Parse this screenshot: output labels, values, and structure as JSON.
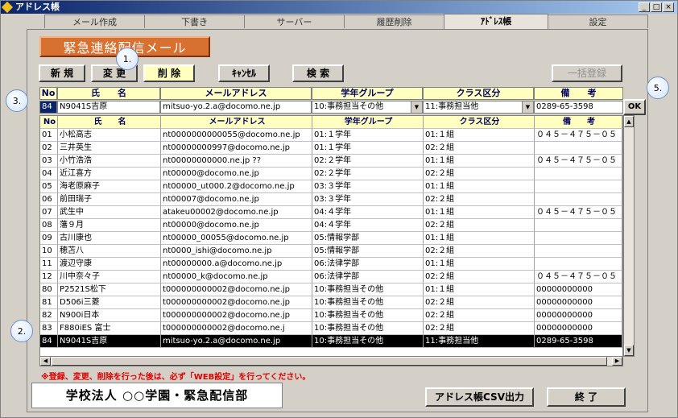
{
  "window": {
    "title": "アドレス帳"
  },
  "tabs": [
    "メール作成",
    "下書き",
    "サーバー",
    "履歴削除",
    "ｱﾄﾞﾚｽ帳",
    "設定"
  ],
  "active_tab_index": 4,
  "banner": {
    "text": "緊急連絡配信メール"
  },
  "toolbar": {
    "new_label": "新 規",
    "edit_label": "変 更",
    "delete_label": "削 除",
    "cancel_label": "ｷｬﾝｾﾙ",
    "search_label": "検 索",
    "bulk_label": "一括登録"
  },
  "callouts": {
    "c1": "1.",
    "c2": "2.",
    "c3": "3.",
    "c5": "5."
  },
  "form": {
    "headers": {
      "no": "No",
      "name": "氏　　名",
      "email": "メールアドレス",
      "grade": "学年グループ",
      "class": "クラス区分",
      "note": "備　　考"
    },
    "values": {
      "no": "84",
      "name": "N9041S吉原",
      "email": "mitsuo-yo.2.a@docomo.ne.jp",
      "grade": "10:事務担当その他",
      "class": "11:事務担当他",
      "note": "0289-65-3598"
    },
    "ok_label": "OK"
  },
  "grid": {
    "headers": {
      "no": "No",
      "name": "氏　　名",
      "email": "メールアドレス",
      "grade": "学年グループ",
      "class": "クラス区分",
      "note": "備　　考"
    },
    "rows": [
      {
        "no": "01",
        "name": "小松高志",
        "email": "nt0000000000055@docomo.ne.jp",
        "grade": "01:１学年",
        "class": "01:１組",
        "note": "０４５－４７５－０５"
      },
      {
        "no": "02",
        "name": "三井英生",
        "email": "nt00000000997@docomo.ne.jp",
        "grade": "01:１学年",
        "class": "02:２組",
        "note": ""
      },
      {
        "no": "03",
        "name": "小竹浩浩",
        "email": "nt00000000000.ne.jp ??",
        "grade": "02:２学年",
        "class": "01:１組",
        "note": "０４５－４７５－０５"
      },
      {
        "no": "04",
        "name": "近江喜方",
        "email": "nt00000@docomo.ne.jp",
        "grade": "02:２学年",
        "class": "02:２組",
        "note": ""
      },
      {
        "no": "05",
        "name": "海老原麻子",
        "email": "nt00000_ut000.2@docomo.ne.jp",
        "grade": "03:３学年",
        "class": "01:１組",
        "note": ""
      },
      {
        "no": "06",
        "name": "前田瑞子",
        "email": "nt00007@docomo.ne.jp",
        "grade": "03:３学年",
        "class": "02:２組",
        "note": ""
      },
      {
        "no": "07",
        "name": "武生中",
        "email": "atakeu00002@docomo.ne.jp",
        "grade": "04:４学年",
        "class": "01:１組",
        "note": "０４５－４７５－０５"
      },
      {
        "no": "08",
        "name": "藩９月",
        "email": "nt00000@docomo.ne.jp",
        "grade": "04:４学年",
        "class": "02:２組",
        "note": ""
      },
      {
        "no": "09",
        "name": "古川康也",
        "email": "nt00000_00055@docomo.ne.jp",
        "grade": "05:情報学部",
        "class": "01:１組",
        "note": ""
      },
      {
        "no": "10",
        "name": "穂苫八",
        "email": "nt0000_ishi@docomo.ne.jp",
        "grade": "05:情報学部",
        "class": "02:２組",
        "note": ""
      },
      {
        "no": "11",
        "name": "渡辺守康",
        "email": "nt00000000.a@docomo.ne.jp",
        "grade": "06:法律学部",
        "class": "01:１組",
        "note": ""
      },
      {
        "no": "12",
        "name": "川中奈々子",
        "email": "nt00000_k@docomo.ne.jp",
        "grade": "06:法律学部",
        "class": "02:２組",
        "note": "０４５－４７５－０５"
      },
      {
        "no": "80",
        "name": "P2521S松下",
        "email": "t000000000002@docomo.ne.jp",
        "grade": "10:事務担当その他",
        "class": "01:１組",
        "note": "00000000000"
      },
      {
        "no": "81",
        "name": "D506i三菱",
        "email": "t000000000002@docomo.ne.jp",
        "grade": "10:事務担当その他",
        "class": "02:２組",
        "note": "00000000000"
      },
      {
        "no": "82",
        "name": "N900i日本",
        "email": "t000000000002@docomo.ne.jp",
        "grade": "10:事務担当その他",
        "class": "02:２組",
        "note": "00000000000"
      },
      {
        "no": "83",
        "name": "F880iES 富士",
        "email": "t000000000002@docomo.ne.j",
        "grade": "10:事務担当その他",
        "class": "02:２組",
        "note": "00000000000"
      },
      {
        "no": "84",
        "name": "N9041S吉原",
        "email": "mitsuo-yo.2.a@docomo.ne.jp",
        "grade": "10:事務担当その他",
        "class": "11:事務担当他",
        "note": "0289-65-3598"
      }
    ]
  },
  "warning": "※登録、変更、削除を行った後は、必ず「WEB設定」を行ってください。",
  "footer": {
    "org": "学校法人 ○○学園・緊急配信部",
    "csv_label": "アドレス帳CSV出力",
    "exit_label": "終 了"
  },
  "icons": {
    "app": "diamond-app-icon"
  },
  "colors": {
    "banner": "#d87030",
    "header_bg": "#ffffc0",
    "selected_row": "#000000",
    "warning": "#e00000"
  }
}
